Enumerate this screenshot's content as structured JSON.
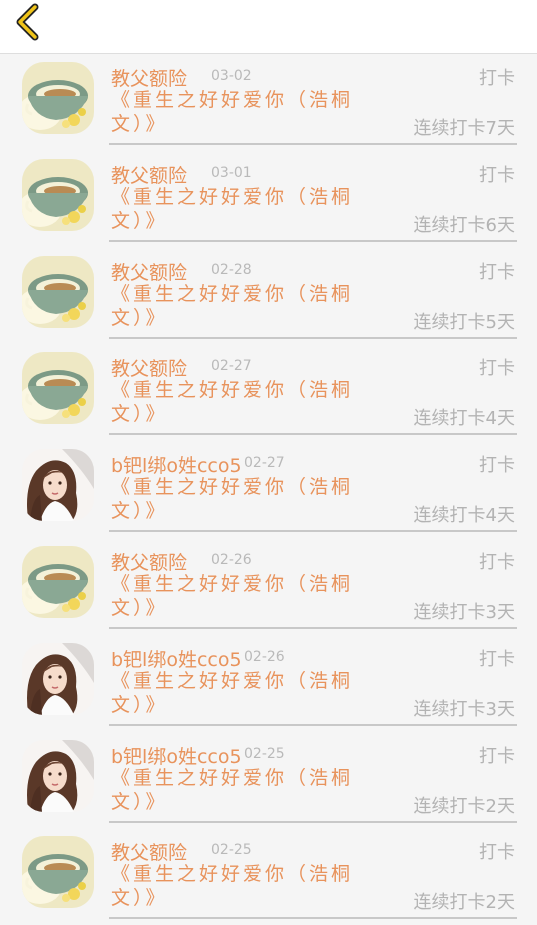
{
  "header": {
    "back_icon": "chevron-left-icon",
    "accent_color": "#f0c419"
  },
  "entries": [
    {
      "user": "教父额险",
      "date": "03-02",
      "action": "打卡",
      "book": "《重生之好好爱你（浩桐文）》",
      "streak": "连续打卡7天",
      "avatar": "teacup-avatar"
    },
    {
      "user": "教父额险",
      "date": "03-01",
      "action": "打卡",
      "book": "《重生之好好爱你（浩桐文）》",
      "streak": "连续打卡6天",
      "avatar": "teacup-avatar"
    },
    {
      "user": "教父额险",
      "date": "02-28",
      "action": "打卡",
      "book": "《重生之好好爱你（浩桐文）》",
      "streak": "连续打卡5天",
      "avatar": "teacup-avatar"
    },
    {
      "user": "教父额险",
      "date": "02-27",
      "action": "打卡",
      "book": "《重生之好好爱你（浩桐文）》",
      "streak": "连续打卡4天",
      "avatar": "teacup-avatar"
    },
    {
      "user": "b钯l绑o姓cco5",
      "date": "02-27",
      "action": "打卡",
      "book": "《重生之好好爱你（浩桐文）》",
      "streak": "连续打卡4天",
      "avatar": "girl-avatar"
    },
    {
      "user": "教父额险",
      "date": "02-26",
      "action": "打卡",
      "book": "《重生之好好爱你（浩桐文）》",
      "streak": "连续打卡3天",
      "avatar": "teacup-avatar"
    },
    {
      "user": "b钯l绑o姓cco5",
      "date": "02-26",
      "action": "打卡",
      "book": "《重生之好好爱你（浩桐文）》",
      "streak": "连续打卡3天",
      "avatar": "girl-avatar"
    },
    {
      "user": "b钯l绑o姓cco5",
      "date": "02-25",
      "action": "打卡",
      "book": "《重生之好好爱你（浩桐文）》",
      "streak": "连续打卡2天",
      "avatar": "girl-avatar"
    },
    {
      "user": "教父额险",
      "date": "02-25",
      "action": "打卡",
      "book": "《重生之好好爱你（浩桐文）》",
      "streak": "连续打卡2天",
      "avatar": "teacup-avatar"
    }
  ],
  "colors": {
    "name": "#e8935c",
    "meta": "#b3b3b3",
    "divider": "#c8c8c8",
    "background": "#f5f5f5"
  }
}
